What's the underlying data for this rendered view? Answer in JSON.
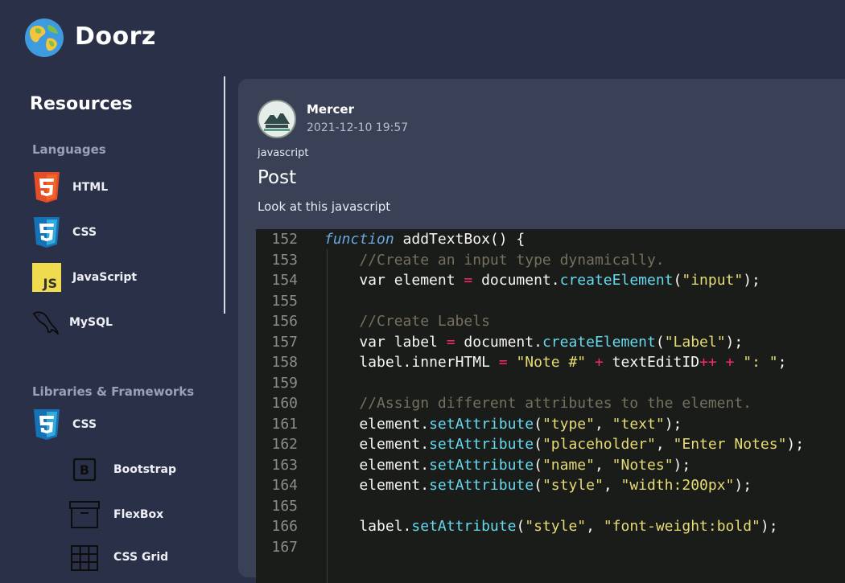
{
  "app": {
    "name": "Doorz"
  },
  "sidebar": {
    "title": "Resources",
    "sections": [
      {
        "label": "Languages",
        "items": [
          {
            "label": "HTML",
            "icon": "html5-icon"
          },
          {
            "label": "CSS",
            "icon": "css3-icon"
          },
          {
            "label": "JavaScript",
            "icon": "javascript-icon"
          },
          {
            "label": "MySQL",
            "icon": "mysql-dolphin-icon"
          }
        ]
      },
      {
        "label": "Libraries & Frameworks",
        "items": [
          {
            "label": "CSS",
            "icon": "css3-icon",
            "children": [
              {
                "label": "Bootstrap",
                "icon": "bootstrap-icon"
              },
              {
                "label": "FlexBox",
                "icon": "flexbox-icon"
              },
              {
                "label": "CSS Grid",
                "icon": "grid-icon"
              }
            ]
          }
        ]
      }
    ]
  },
  "post": {
    "author": "Mercer",
    "timestamp": "2021-12-10 19:57",
    "tag": "javascript",
    "title": "Post",
    "body": "Look at this javascript",
    "code": {
      "line_numbers": [
        "152",
        "153",
        "154",
        "155",
        "156",
        "157",
        "158",
        "159",
        "160",
        "161",
        "162",
        "163",
        "164",
        "165",
        "166",
        "167"
      ],
      "lines": [
        "function addTextBox() {",
        "    //Create an input type dynamically.",
        "    var element = document.createElement(\"input\");",
        "",
        "    //Create Labels",
        "    var label = document.createElement(\"Label\");",
        "    label.innerHTML = \"Note #\" + textEditID++ + \": \";",
        "",
        "    //Assign different attributes to the element.",
        "    element.setAttribute(\"type\", \"text\");",
        "    element.setAttribute(\"placeholder\", \"Enter Notes\");",
        "    element.setAttribute(\"name\", \"Notes\");",
        "    element.setAttribute(\"style\", \"width:200px\");",
        "",
        "    label.setAttribute(\"style\", \"font-weight:bold\");",
        ""
      ]
    }
  },
  "colors": {
    "background": "#2a3047",
    "card": "#3a4056",
    "code_background": "#1a1c19",
    "keyword": "#6aa7e4",
    "function": "#a6e22e",
    "string": "#e6db74",
    "operator": "#f92672",
    "comment": "#75715e"
  }
}
